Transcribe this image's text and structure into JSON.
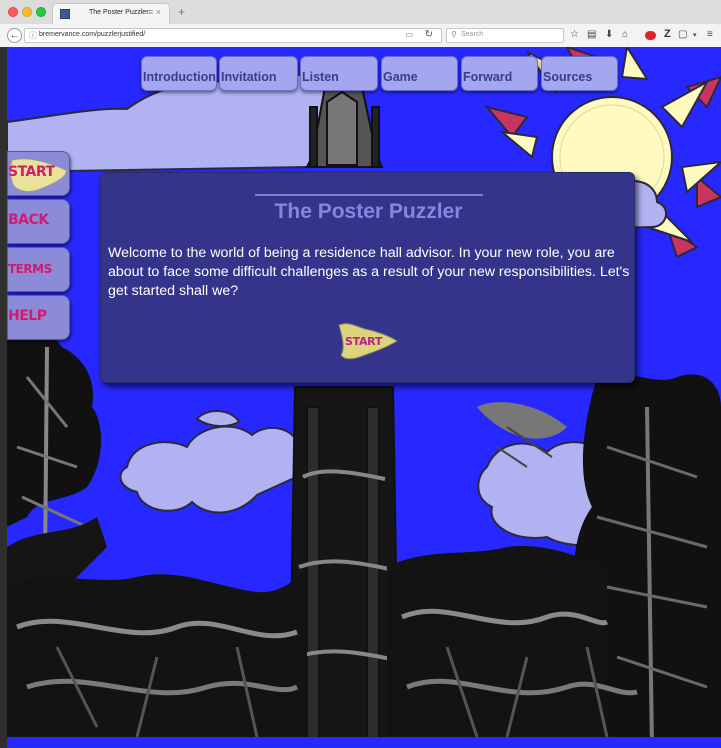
{
  "browser": {
    "tab_title": "The Poster Puzzler",
    "tab_close": "≡ ×",
    "new_tab": "+",
    "url": "bremervance.com/puzzlerjustified/",
    "search_placeholder": "Search",
    "zotero": "Z"
  },
  "nav": {
    "tabs": [
      "Introduction",
      "Invitation",
      "Listen",
      "Game",
      "Forward",
      "Sources"
    ]
  },
  "side": {
    "buttons": [
      "START",
      "BACK",
      "TERMS",
      "HELP"
    ]
  },
  "dialog": {
    "title": "The Poster Puzzler",
    "body": "Welcome to the world of being a residence hall advisor. In your new role, you are about to face some difficult challenges as a result of your new responsibilities. Let's get started shall we?",
    "start_label": "START"
  },
  "colors": {
    "sky": "#2727ff",
    "cloud": "#b0b2f2",
    "sun": "#fffac0",
    "dialog_bg": "#34348a",
    "tab_bg": "#a4a6ef",
    "accent_pink": "#d21b6f"
  }
}
